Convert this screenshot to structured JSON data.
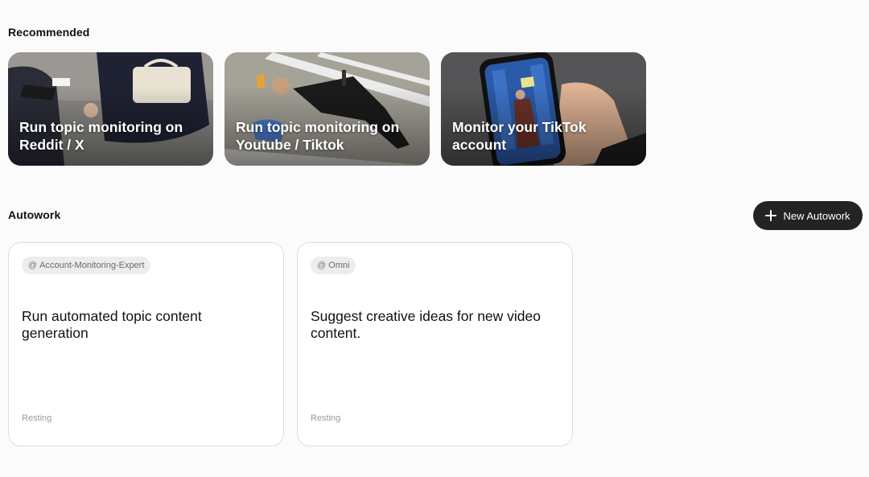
{
  "recommended": {
    "title": "Recommended",
    "cards": [
      {
        "label": "Run topic monitoring on Reddit / X"
      },
      {
        "label": "Run topic monitoring on Youtube / Tiktok"
      },
      {
        "label": "Monitor your TikTok account"
      }
    ]
  },
  "autowork": {
    "title": "Autowork",
    "new_button_label": "New Autowork",
    "cards": [
      {
        "agent": "Account-Monitoring-Expert",
        "description": "Run automated topic content generation",
        "status": "Resting"
      },
      {
        "agent": "Omni",
        "description": "Suggest creative ideas for new video content.",
        "status": "Resting"
      }
    ]
  },
  "icons": {
    "new_button": "plus-icon",
    "agent_tag": "at-icon"
  },
  "colors": {
    "button_bg": "#222325",
    "tag_bg": "#ededee",
    "status_text": "#9a9a9a"
  }
}
